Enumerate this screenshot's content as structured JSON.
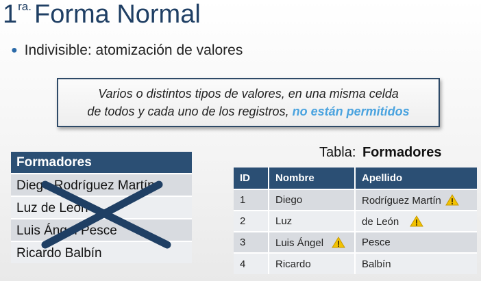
{
  "title": {
    "number": "1",
    "superscript": "ra.",
    "text": "Forma Normal"
  },
  "bullet": {
    "text": "Indivisible:  atomización de valores"
  },
  "callout": {
    "line1": "Varios o distintos tipos de valores, en una misma  celda",
    "line2": "de todos y cada uno de los registros, ",
    "highlight": "no están permitidos",
    "highlight_color": "#4aa3df"
  },
  "left_table": {
    "header": "Formadores",
    "rows": [
      "Diego Rodríguez Martín",
      "Luz de León",
      "Luis Ángel Pesce",
      "Ricardo Balbín"
    ]
  },
  "right_table": {
    "caption_prefix": "Tabla:",
    "caption_name": "Formadores",
    "columns": [
      "ID",
      "Nombre",
      "Apellido"
    ],
    "rows": [
      {
        "id": "1",
        "nombre": "Diego",
        "apellido": "Rodríguez Martín"
      },
      {
        "id": "2",
        "nombre": "Luz",
        "apellido": "de León"
      },
      {
        "id": "3",
        "nombre": "Luis Ángel",
        "apellido": "Pesce"
      },
      {
        "id": "4",
        "nombre": "Ricardo",
        "apellido": "Balbín"
      }
    ]
  },
  "colors": {
    "header_bg": "#2b4f74",
    "title": "#1f3f64",
    "warning": "#f2c200"
  },
  "icons": {
    "cross": "cross-out-icon",
    "warning": "warning-icon"
  }
}
